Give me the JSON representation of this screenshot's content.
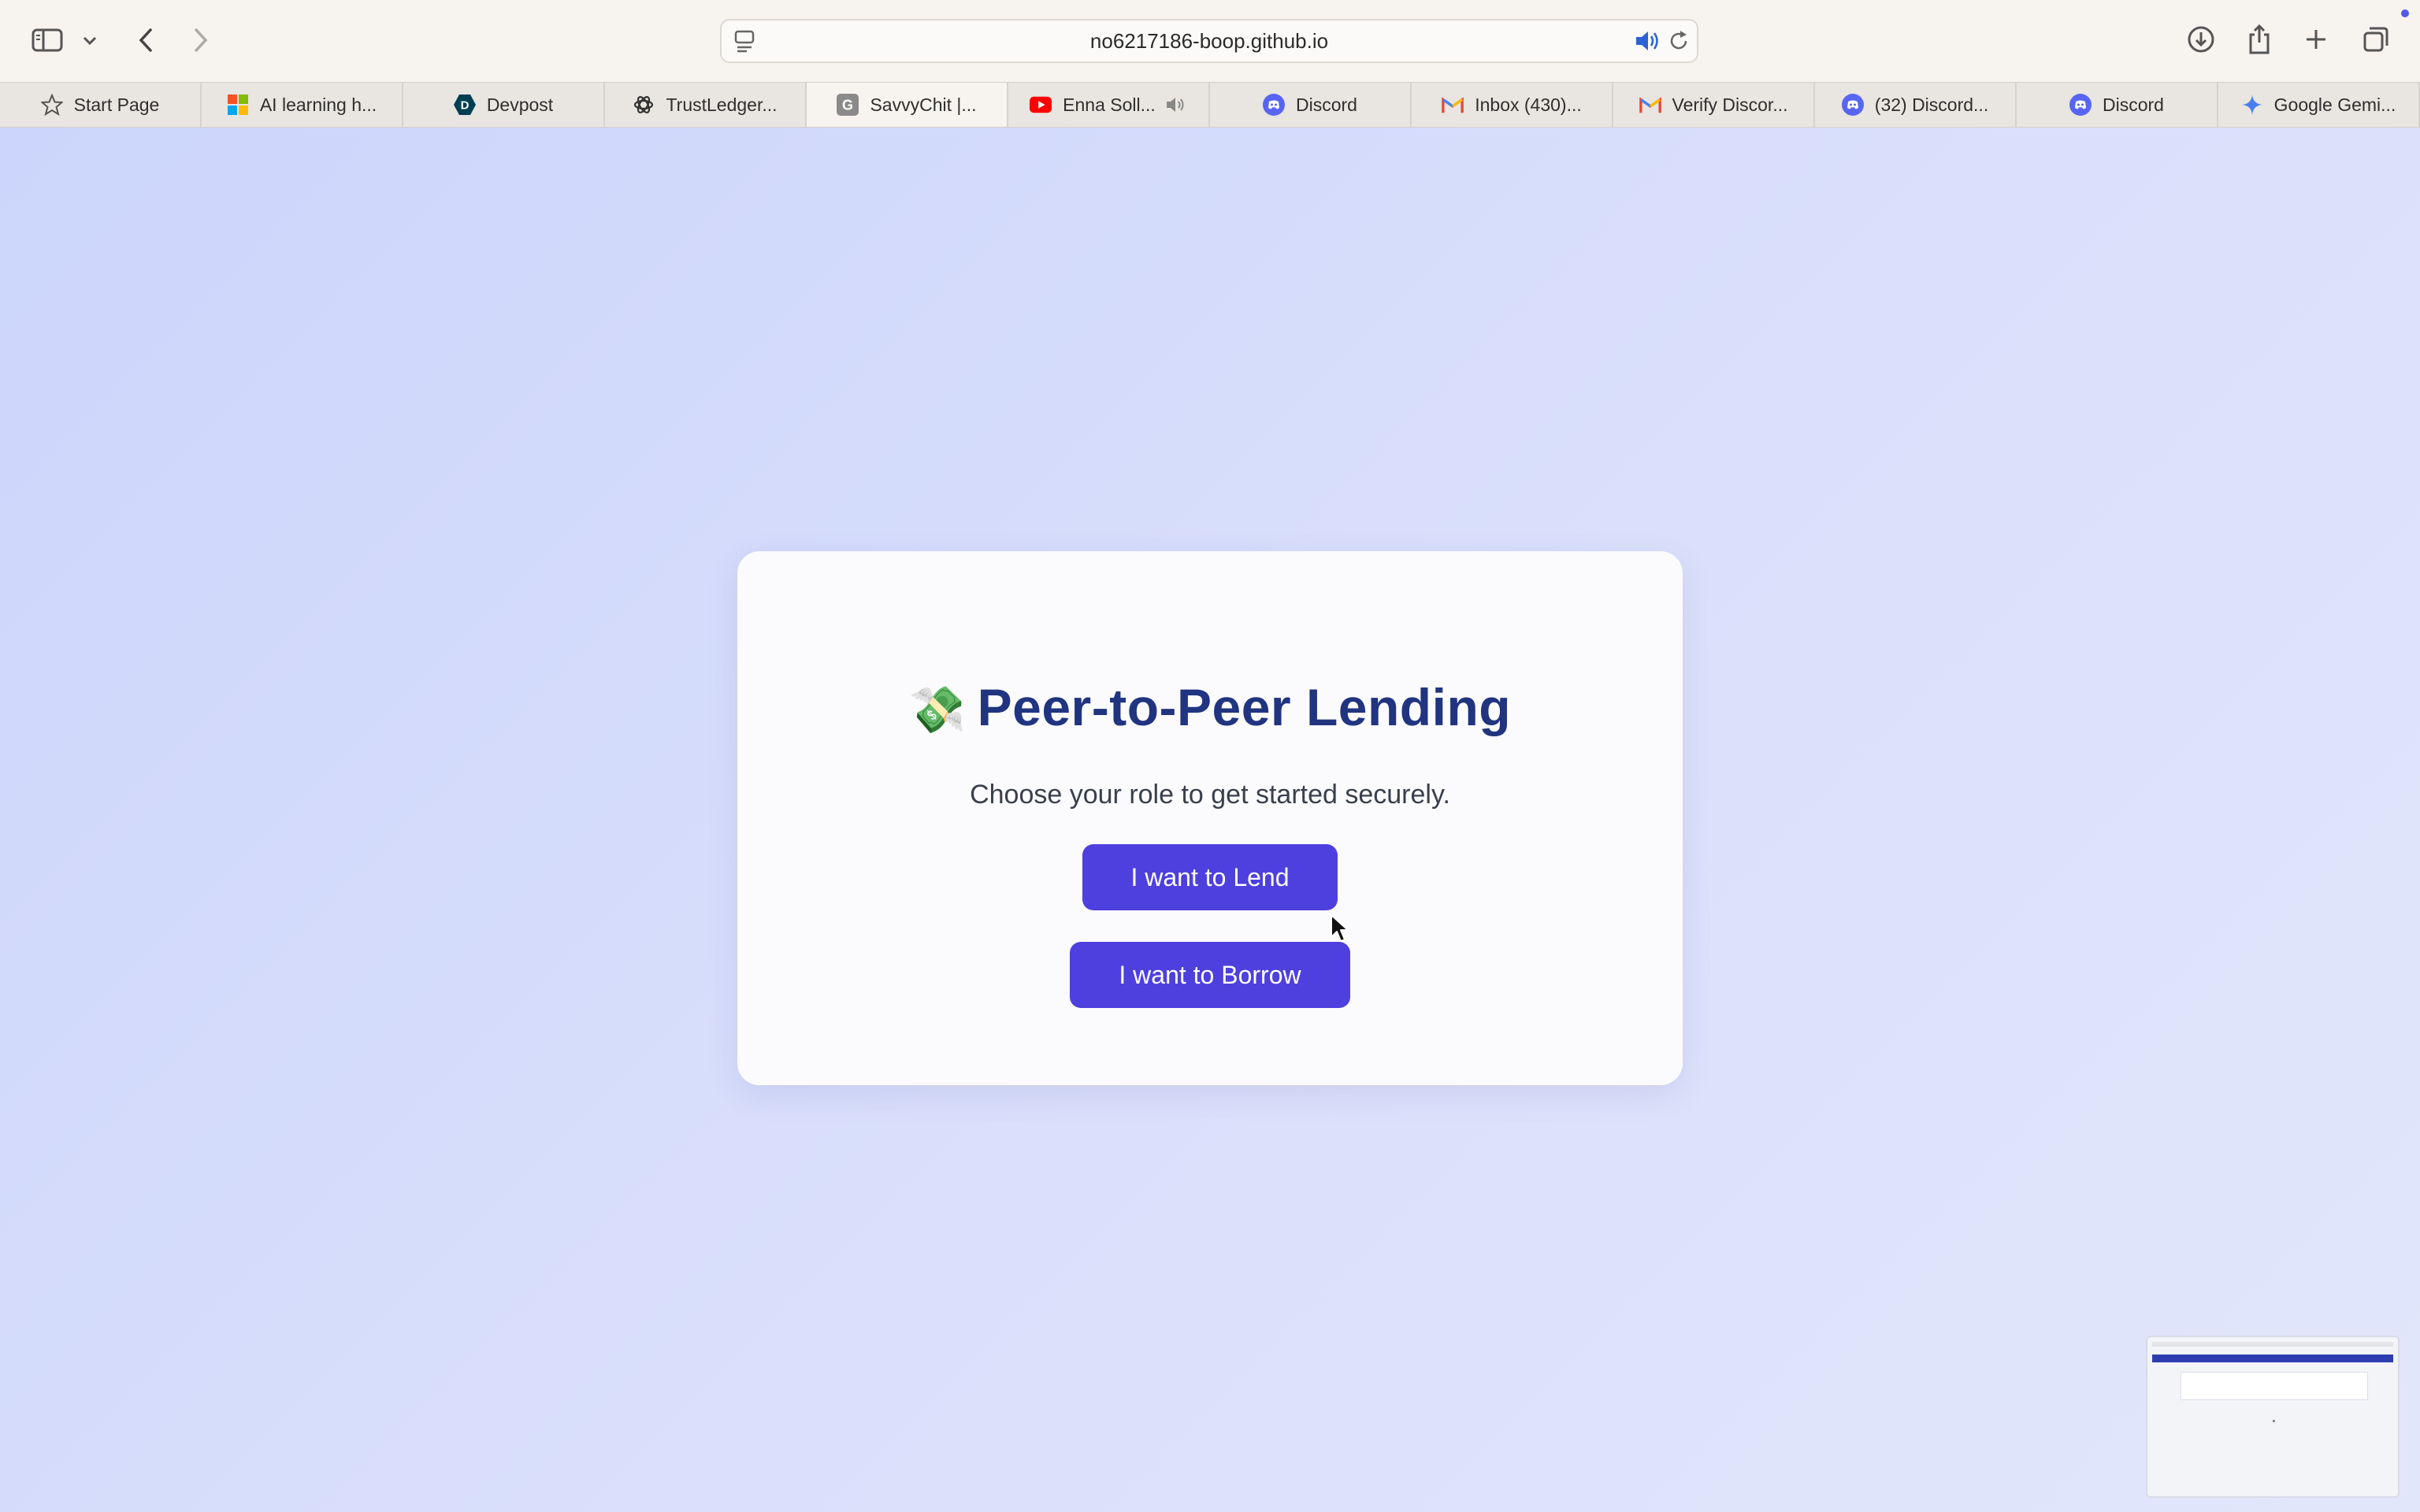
{
  "browser": {
    "url": "no6217186-boop.github.io",
    "tabs": [
      {
        "label": "Start Page",
        "icon": "star-icon"
      },
      {
        "label": "AI learning h...",
        "icon": "microsoft-icon"
      },
      {
        "label": "Devpost",
        "icon": "devpost-icon"
      },
      {
        "label": "TrustLedger...",
        "icon": "openai-icon"
      },
      {
        "label": "SavvyChit |...",
        "icon": "g-icon",
        "active": true
      },
      {
        "label": "Enna Soll...",
        "icon": "youtube-icon",
        "audio": true
      },
      {
        "label": "Discord",
        "icon": "discord-icon"
      },
      {
        "label": "Inbox (430)...",
        "icon": "gmail-icon"
      },
      {
        "label": "Verify Discor...",
        "icon": "gmail-icon"
      },
      {
        "label": "(32) Discord...",
        "icon": "discord-icon"
      },
      {
        "label": "Discord",
        "icon": "discord-icon"
      },
      {
        "label": "Google Gemi...",
        "icon": "gemini-icon"
      }
    ]
  },
  "card": {
    "emoji": "💸",
    "title": "Peer-to-Peer Lending",
    "subtitle": "Choose your role to get started securely.",
    "lend_label": "I want to Lend",
    "borrow_label": "I want to Borrow"
  },
  "colors": {
    "accent": "#4d40df",
    "title": "#203480",
    "background": "#dde2fb"
  }
}
